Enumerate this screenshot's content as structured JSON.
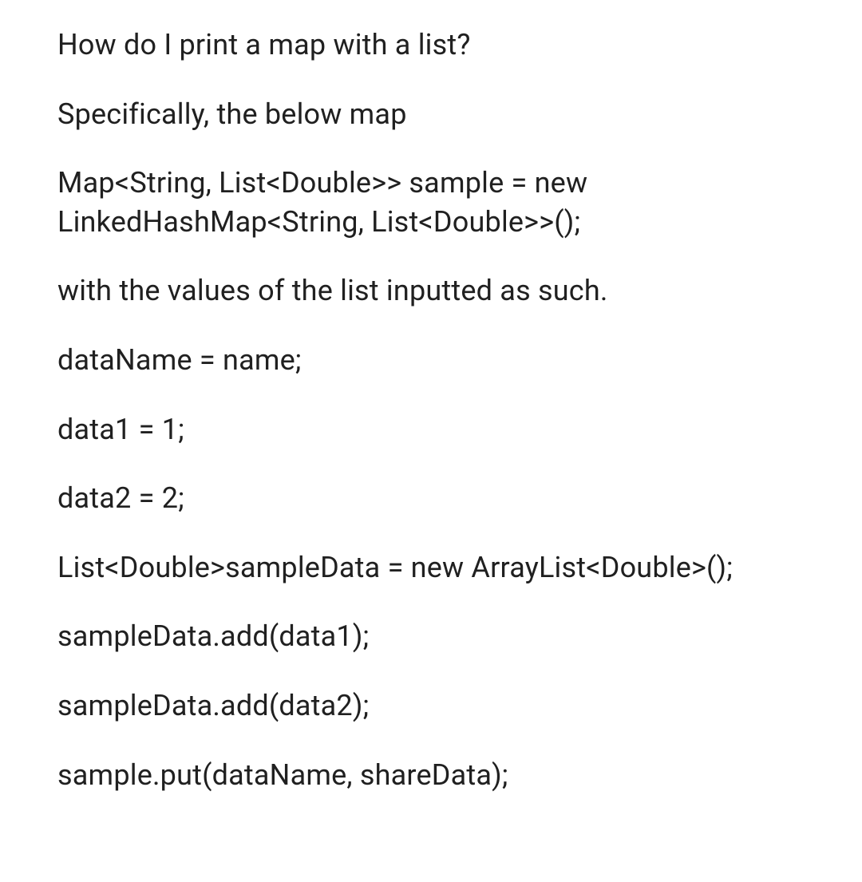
{
  "paragraphs": [
    "How do I print a map with a list?",
    "Specifically, the below map",
    "Map<String, List<Double>> sample = new LinkedHashMap<String, List<Double>>();",
    "with the values of the list inputted as such.",
    "dataName = name;",
    "data1 = 1;",
    "data2 = 2;",
    "List<Double>sampleData = new ArrayList<Double>();",
    "sampleData.add(data1);",
    "sampleData.add(data2);",
    "sample.put(dataName, shareData);"
  ]
}
